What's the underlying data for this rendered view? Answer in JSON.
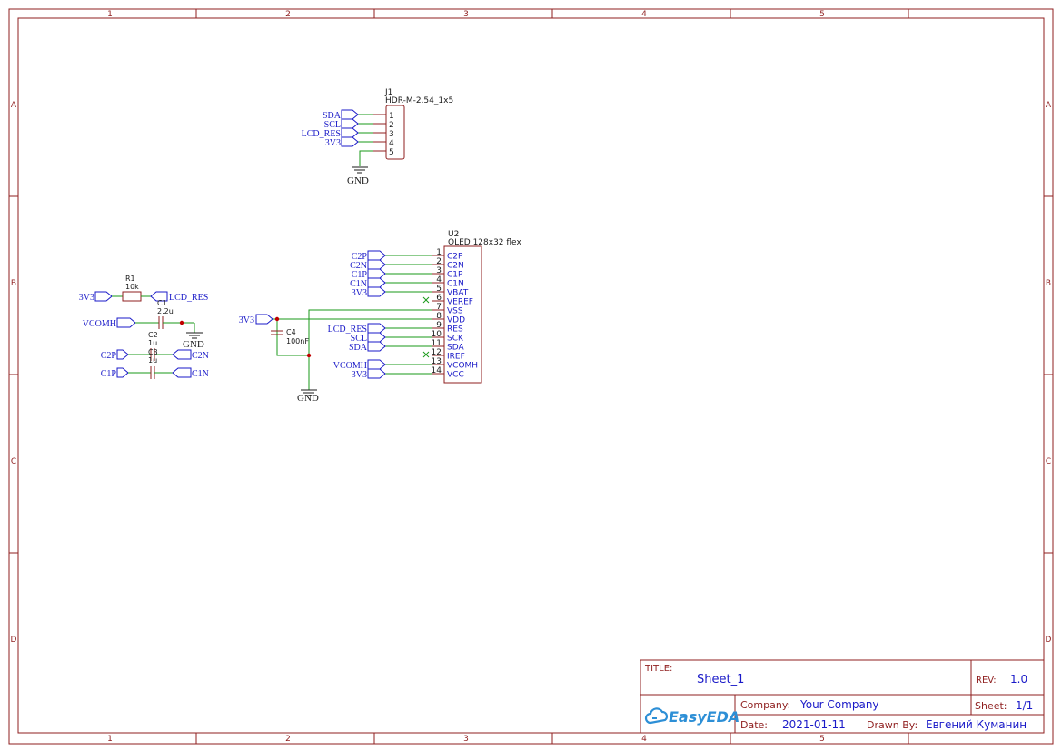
{
  "sheet": {
    "col_labels": [
      "1",
      "2",
      "3",
      "4",
      "5"
    ],
    "row_labels": [
      "A",
      "B",
      "C",
      "D"
    ]
  },
  "title_block": {
    "title_label": "TITLE:",
    "title": "Sheet_1",
    "rev_label": "REV:",
    "rev": "1.0",
    "company_label": "Company:",
    "company": "Your Company",
    "sheet_label": "Sheet:",
    "sheet": "1/1",
    "date_label": "Date:",
    "date": "2021-01-11",
    "drawn_label": "Drawn By:",
    "drawn_by": "Евгений Куманин",
    "logo": "EasyEDA",
    "logo_icon": "cloud-icon"
  },
  "j1": {
    "ref": "J1",
    "value": "HDR-M-2.54_1x5",
    "pins": [
      "1",
      "2",
      "3",
      "4",
      "5"
    ],
    "nets": [
      "SDA",
      "SCL",
      "LCD_RES",
      "3V3"
    ],
    "gnd": "GND"
  },
  "u2": {
    "ref": "U2",
    "value": "OLED 128x32 flex",
    "pins": [
      {
        "num": "1",
        "name": "C2P",
        "net": "C2P"
      },
      {
        "num": "2",
        "name": "C2N",
        "net": "C2N"
      },
      {
        "num": "3",
        "name": "C1P",
        "net": "C1P"
      },
      {
        "num": "4",
        "name": "C1N",
        "net": "C1N"
      },
      {
        "num": "5",
        "name": "VBAT",
        "net": "3V3"
      },
      {
        "num": "6",
        "name": "VEREF",
        "net": ""
      },
      {
        "num": "7",
        "name": "VSS",
        "net": ""
      },
      {
        "num": "8",
        "name": "VDD",
        "net": ""
      },
      {
        "num": "9",
        "name": "RES",
        "net": "LCD_RES"
      },
      {
        "num": "10",
        "name": "SCK",
        "net": "SCL"
      },
      {
        "num": "11",
        "name": "SDA",
        "net": "SDA"
      },
      {
        "num": "12",
        "name": "IREF",
        "net": ""
      },
      {
        "num": "13",
        "name": "VCOMH",
        "net": "VCOMH"
      },
      {
        "num": "14",
        "name": "VCC",
        "net": "3V3"
      }
    ]
  },
  "c4": {
    "ref": "C4",
    "value": "100nF",
    "net": "3V3",
    "gnd": "GND"
  },
  "passives": {
    "r1": {
      "ref": "R1",
      "value": "10k",
      "net_left": "3V3",
      "net_right": "LCD_RES"
    },
    "c1": {
      "ref": "C1",
      "value": "2.2u",
      "net_left": "VCOMH",
      "gnd": "GND"
    },
    "c2": {
      "ref": "C2",
      "value": "1u",
      "net_left": "C2P",
      "net_right": "C2N"
    },
    "c3": {
      "ref": "C3",
      "value": "1u",
      "net_left": "C1P",
      "net_right": "C1N"
    }
  }
}
